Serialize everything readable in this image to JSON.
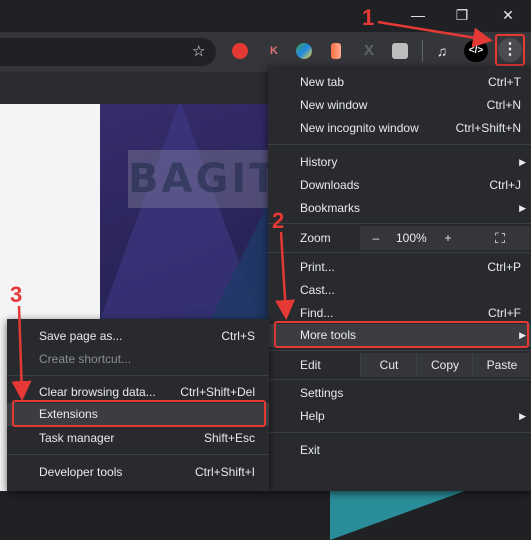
{
  "window": {
    "minimize": "—",
    "restore": "❐",
    "close": "✕"
  },
  "toolbar": {
    "star": "☆",
    "code_ext": "</>",
    "kebab": "⋮"
  },
  "watermark": "BAGITEKNO",
  "menu": {
    "new_tab": {
      "label": "New tab",
      "shortcut": "Ctrl+T"
    },
    "new_window": {
      "label": "New window",
      "shortcut": "Ctrl+N"
    },
    "new_incognito": {
      "label": "New incognito window",
      "shortcut": "Ctrl+Shift+N"
    },
    "history": {
      "label": "History"
    },
    "downloads": {
      "label": "Downloads",
      "shortcut": "Ctrl+J"
    },
    "bookmarks": {
      "label": "Bookmarks"
    },
    "zoom": {
      "label": "Zoom",
      "minus": "–",
      "value": "100%",
      "plus": "+",
      "fullscreen": "⛶"
    },
    "print": {
      "label": "Print...",
      "shortcut": "Ctrl+P"
    },
    "cast": {
      "label": "Cast..."
    },
    "find": {
      "label": "Find...",
      "shortcut": "Ctrl+F"
    },
    "more_tools": {
      "label": "More tools"
    },
    "edit": {
      "label": "Edit",
      "cut": "Cut",
      "copy": "Copy",
      "paste": "Paste"
    },
    "settings": {
      "label": "Settings"
    },
    "help": {
      "label": "Help"
    },
    "exit": {
      "label": "Exit"
    }
  },
  "submenu": {
    "save_page": {
      "label": "Save page as...",
      "shortcut": "Ctrl+S"
    },
    "create_shortcut": {
      "label": "Create shortcut..."
    },
    "clear_data": {
      "label": "Clear browsing data...",
      "shortcut": "Ctrl+Shift+Del"
    },
    "extensions": {
      "label": "Extensions"
    },
    "task_manager": {
      "label": "Task manager",
      "shortcut": "Shift+Esc"
    },
    "developer_tools": {
      "label": "Developer tools",
      "shortcut": "Ctrl+Shift+I"
    }
  },
  "annotations": {
    "n1": "1",
    "n2": "2",
    "n3": "3"
  },
  "colors": {
    "accent_red": "#e53935",
    "menu_bg": "#292a2d"
  }
}
